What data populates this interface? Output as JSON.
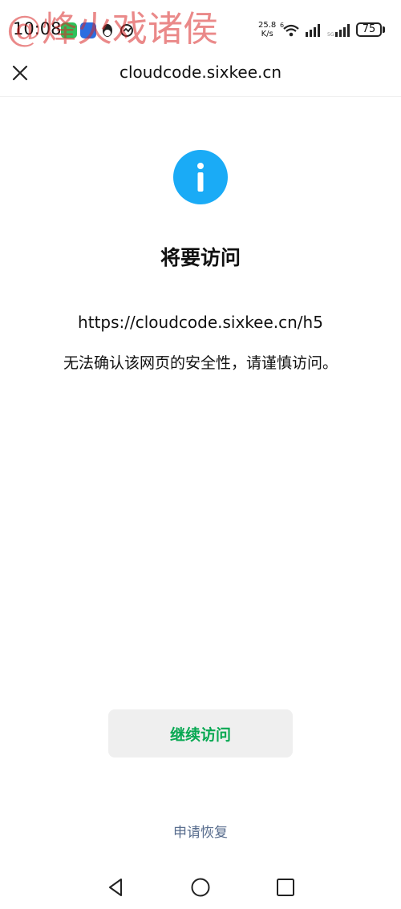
{
  "status_bar": {
    "time": "10:08",
    "watermark": "@烽火戏诸侯",
    "net_speed_value": "25.8",
    "net_speed_unit": "K/s",
    "battery": "75",
    "app_icons": [
      "wechat-icon",
      "app-check-icon",
      "qq-icon",
      "sync-icon"
    ]
  },
  "top_bar": {
    "title": "cloudcode.sixkee.cn"
  },
  "content": {
    "info_icon_color": "#1aabf6",
    "headline": "将要访问",
    "url": "https://cloudcode.sixkee.cn/h5",
    "warning": "无法确认该网页的安全性，请谨慎访问。"
  },
  "actions": {
    "continue_label": "继续访问",
    "continue_color": "#07a852",
    "recover_label": "申请恢复"
  },
  "nav_bar": {
    "buttons": [
      "back-icon",
      "home-icon",
      "recents-icon"
    ]
  }
}
